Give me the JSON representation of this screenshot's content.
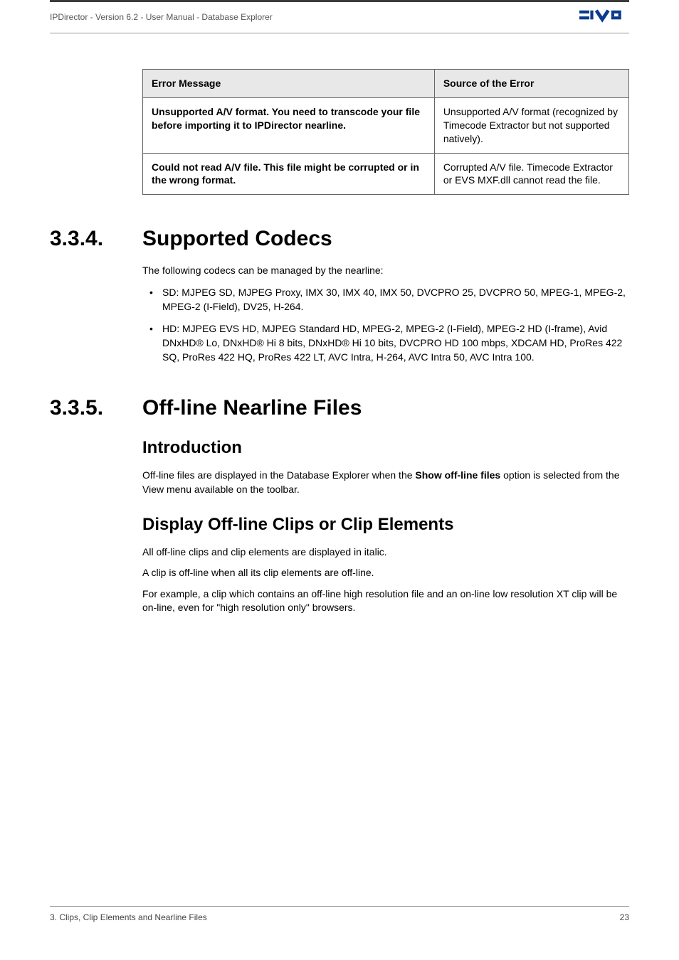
{
  "header": {
    "breadcrumb": "IPDirector - Version 6.2 - User Manual - Database Explorer"
  },
  "table": {
    "headers": [
      "Error Message",
      "Source of the Error"
    ],
    "rows": [
      {
        "msg": "Unsupported A/V format. You need to transcode your file before importing it to IPDirector nearline.",
        "src": "Unsupported A/V format (recognized by Timecode Extractor but not supported natively)."
      },
      {
        "msg": "Could not read A/V file. This file might be corrupted or in the wrong format.",
        "src": "Corrupted A/V file. Timecode Extractor or EVS MXF.dll cannot read the file."
      }
    ]
  },
  "sec334": {
    "num": "3.3.4.",
    "title": "Supported Codecs",
    "intro": "The following codecs can be managed by the nearline:",
    "bullets": [
      "SD: MJPEG SD, MJPEG Proxy, IMX 30, IMX 40, IMX 50, DVCPRO 25, DVCPRO 50, MPEG-1, MPEG-2, MPEG-2 (I-Field), DV25, H-264.",
      "HD: MJPEG EVS HD, MJPEG Standard HD, MPEG-2, MPEG-2 (I-Field), MPEG-2 HD (I-frame), Avid DNxHD® Lo, DNxHD® Hi 8 bits, DNxHD® Hi 10 bits, DVCPRO HD 100 mbps, XDCAM HD, ProRes 422 SQ, ProRes 422 HQ, ProRes 422 LT, AVC Intra, H-264, AVC Intra 50, AVC Intra 100."
    ]
  },
  "sec335": {
    "num": "3.3.5.",
    "title": "Off-line Nearline Files",
    "intro_head": "Introduction",
    "intro_p1a": "Off-line files are displayed in the Database Explorer when the ",
    "intro_bold": "Show off-line files",
    "intro_p1b": " option is selected from the View menu available on the toolbar.",
    "disp_head": "Display Off-line Clips or Clip Elements",
    "disp_p1": "All off-line clips and clip elements are displayed in italic.",
    "disp_p2": "A clip is off-line when all its clip elements are off-line.",
    "disp_p3": "For example, a clip which contains an off-line high resolution file and an on-line low resolution XT clip will be on-line, even for \"high resolution only\" browsers."
  },
  "footer": {
    "left": "3. Clips, Clip Elements and Nearline Files",
    "right": "23"
  }
}
